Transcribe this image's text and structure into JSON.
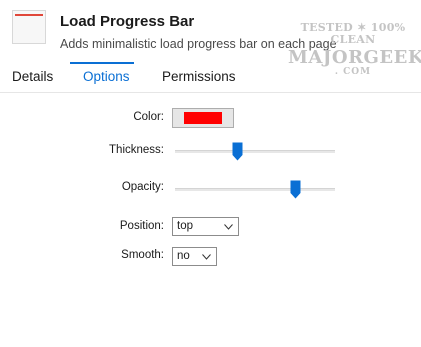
{
  "header": {
    "title": "Load Progress Bar",
    "subtitle": "Adds minimalistic load progress bar on each page"
  },
  "watermark": {
    "line1": "TESTED ✶ 100% CLEAN",
    "line2": "MAJORGEEKS",
    "line3": ". COM"
  },
  "tabs": [
    {
      "label": "Details",
      "active": false
    },
    {
      "label": "Options",
      "active": true
    },
    {
      "label": "Permissions",
      "active": false
    }
  ],
  "options": {
    "color": {
      "label": "Color:",
      "value": "#ff0000"
    },
    "thickness": {
      "label": "Thickness:",
      "level": 0.38
    },
    "opacity": {
      "label": "Opacity:",
      "level": 0.77
    },
    "position": {
      "label": "Position:",
      "selected": "top"
    },
    "smooth": {
      "label": "Smooth:",
      "selected": "no"
    }
  },
  "colors": {
    "accent": "#0a6fd4",
    "slider_thumb": "#0a6fd4"
  },
  "icons": {
    "extension": "extension-icon",
    "dropdown": "chevron-down-icon"
  }
}
